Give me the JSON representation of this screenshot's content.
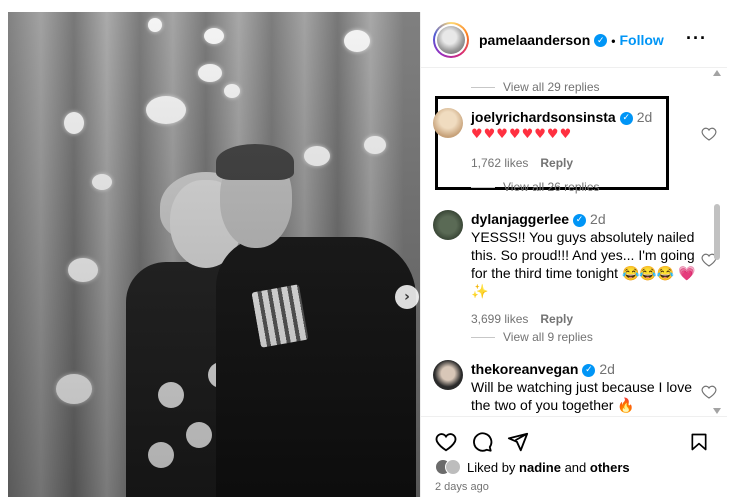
{
  "header": {
    "username": "pamelaanderson",
    "separator": "•",
    "follow_label": "Follow",
    "more_label": "···"
  },
  "comments": [
    {
      "view_replies": "View all 29 replies"
    },
    {
      "username": "joelyrichardsonsinsta",
      "time": "2d",
      "text": "♥♥♥♥♥♥♥♥",
      "likes": "1,762 likes",
      "reply_label": "Reply",
      "view_replies": "View all 26 replies"
    },
    {
      "username": "dylanjaggerlee",
      "time": "2d",
      "text": "YESSS!! You guys absolutely nailed this. So proud!!! And yes... I'm going for the third time tonight 😂😂😂 💗✨",
      "likes": "3,699 likes",
      "reply_label": "Reply",
      "view_replies": "View all 9 replies"
    },
    {
      "username": "thekoreanvegan",
      "time": "2d",
      "text": "Will be watching just because I love the two of you together 🔥"
    }
  ],
  "likes_summary": {
    "prefix": "Liked by",
    "user": "nadine",
    "and": "and",
    "others": "others"
  },
  "timeago": "2 days ago",
  "colors": {
    "accent": "#0095f6",
    "muted": "#737373",
    "heart": "#ff3040"
  },
  "icons": [
    "chevron-right-icon",
    "verified-icon",
    "more-icon",
    "heart-icon",
    "comment-icon",
    "share-icon",
    "bookmark-icon"
  ]
}
